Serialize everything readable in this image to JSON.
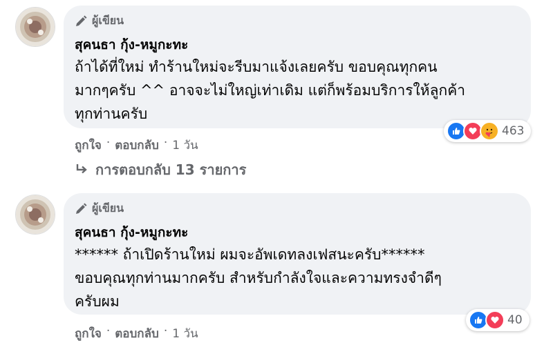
{
  "comments": [
    {
      "author_badge": "ผู้เขียน",
      "author_name": "สุคนธา กุ้ง-หมูกะทะ",
      "lines": [
        "ถ้าได้ที่ใหม่ ทำร้านใหม่จะรีบมาแจ้งเลยครับ ขอบคุณทุกคน",
        "มากๆครับ ^^ อาจจะไม่ใหญ่เท่าเดิม แต่ก็พร้อมบริการให้ลูกค้า",
        "ทุกท่านครับ"
      ],
      "like_label": "ถูกใจ",
      "reply_label": "ตอบกลับ",
      "separator": "·",
      "time": "1 วัน",
      "reaction_icons": [
        "like-icon",
        "love-icon",
        "care-icon"
      ],
      "reaction_count": "463"
    },
    {
      "author_badge": "ผู้เขียน",
      "author_name": "สุคนธา กุ้ง-หมูกะทะ",
      "lines": [
        "****** ถ้าเปิดร้านใหม่ ผมจะอัพเดทลงเฟสนะครับ******",
        "ขอบคุณทุกท่านมากครับ สำหรับกำลังใจและความทรงจำดีๆ",
        "ครับผม"
      ],
      "like_label": "ถูกใจ",
      "reply_label": "ตอบกลับ",
      "separator": "·",
      "time": "1 วัน",
      "reaction_icons": [
        "like-icon",
        "love-icon"
      ],
      "reaction_count": "40"
    }
  ],
  "replies_link": {
    "icon": "reply-arrow-icon",
    "label": "การตอบกลับ 13 รายการ"
  },
  "colors": {
    "bubble": "#f0f2f5",
    "meta_text": "#65676b",
    "like": "#1877f2",
    "love": "#f33e58",
    "care": "#f7b125"
  }
}
